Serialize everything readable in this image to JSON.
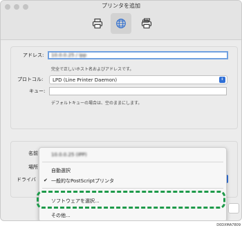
{
  "window": {
    "title": "プリンタを追加"
  },
  "toolbar": {
    "buttons": [
      {
        "name": "default-printer",
        "icon": "printer-icon"
      },
      {
        "name": "ip-printer",
        "icon": "globe-icon",
        "selected": true
      },
      {
        "name": "windows-printer",
        "icon": "printer-stack-icon"
      }
    ]
  },
  "form": {
    "address_label": "アドレス:",
    "address_value": "10.0.0.25 / ipp",
    "address_hint": "完全で正しいホスト名およびアドレスです。",
    "protocol_label": "プロトコル:",
    "protocol_value": "LPD (Line Printer Daemon)",
    "queue_label": "キュー:",
    "queue_value": "",
    "queue_hint": "デフォルトキューの場合は、空のままにします。"
  },
  "lower_form": {
    "name_label": "名前",
    "location_label": "場所",
    "driver_label": "ドライバ"
  },
  "menu": {
    "blurred_item": "10.0.0.25 (IPP)",
    "auto_select": "自動選択",
    "generic_postscript": "一般的なPostScriptプリンタ",
    "select_software": "ソフトウェアを選択...",
    "other": "その他..."
  },
  "image_code": "D0DXMA7809",
  "colors": {
    "highlight": "#1e9a4a",
    "focus": "#6fa0e0",
    "select_accent": "#2f6fd6"
  }
}
